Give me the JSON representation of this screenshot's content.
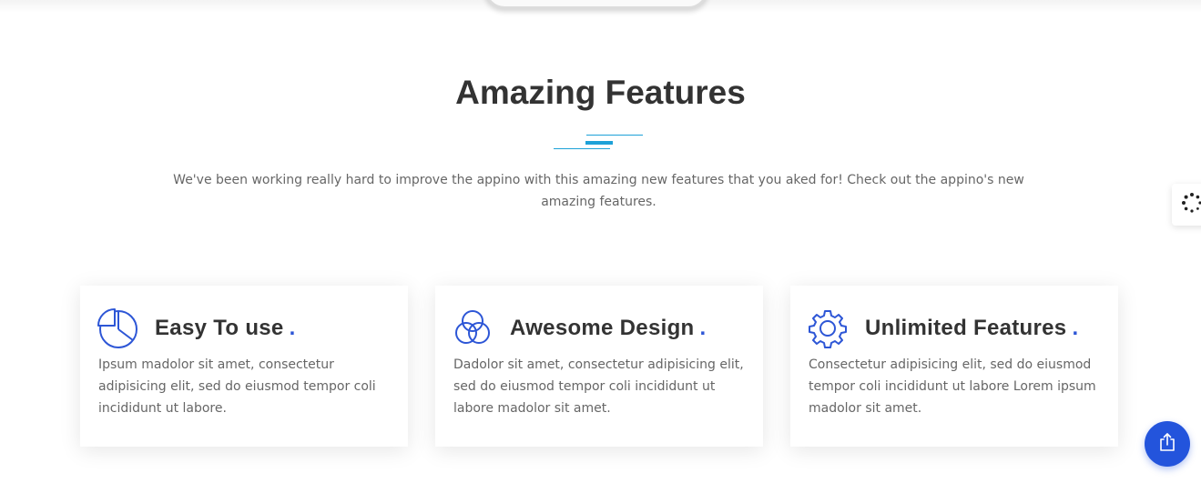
{
  "section": {
    "title": "Amazing Features",
    "subtitle": "We've been working really hard to improve the appino with this amazing new features that you aked for! Check out the appino's new amazing features."
  },
  "features": [
    {
      "icon": "pie-chart-icon",
      "title": "Easy To use",
      "dot": ".",
      "text": "Ipsum madolor sit amet, consectetur adipisicing elit, sed do eiusmod tempor coli incididunt ut labore."
    },
    {
      "icon": "circles-icon",
      "title": "Awesome Design",
      "dot": ".",
      "text": "Dadolor sit amet, consectetur adipisicing elit, sed do eiusmod tempor coli incididunt ut labore madolor sit amet."
    },
    {
      "icon": "gear-icon",
      "title": "Unlimited Features",
      "dot": ".",
      "text": "Consectetur adipisicing elit, sed do eiusmod tempor coli incididunt ut labore Lorem ipsum madolor sit amet."
    }
  ],
  "widgets": {
    "side_widget_icon": "spinner-icon",
    "share_button_icon": "share-icon"
  },
  "colors": {
    "accent": "#2d56d6",
    "divider": "#1da1d8",
    "share_button": "#2354dc",
    "heading": "#333333",
    "body_text": "#666666"
  }
}
